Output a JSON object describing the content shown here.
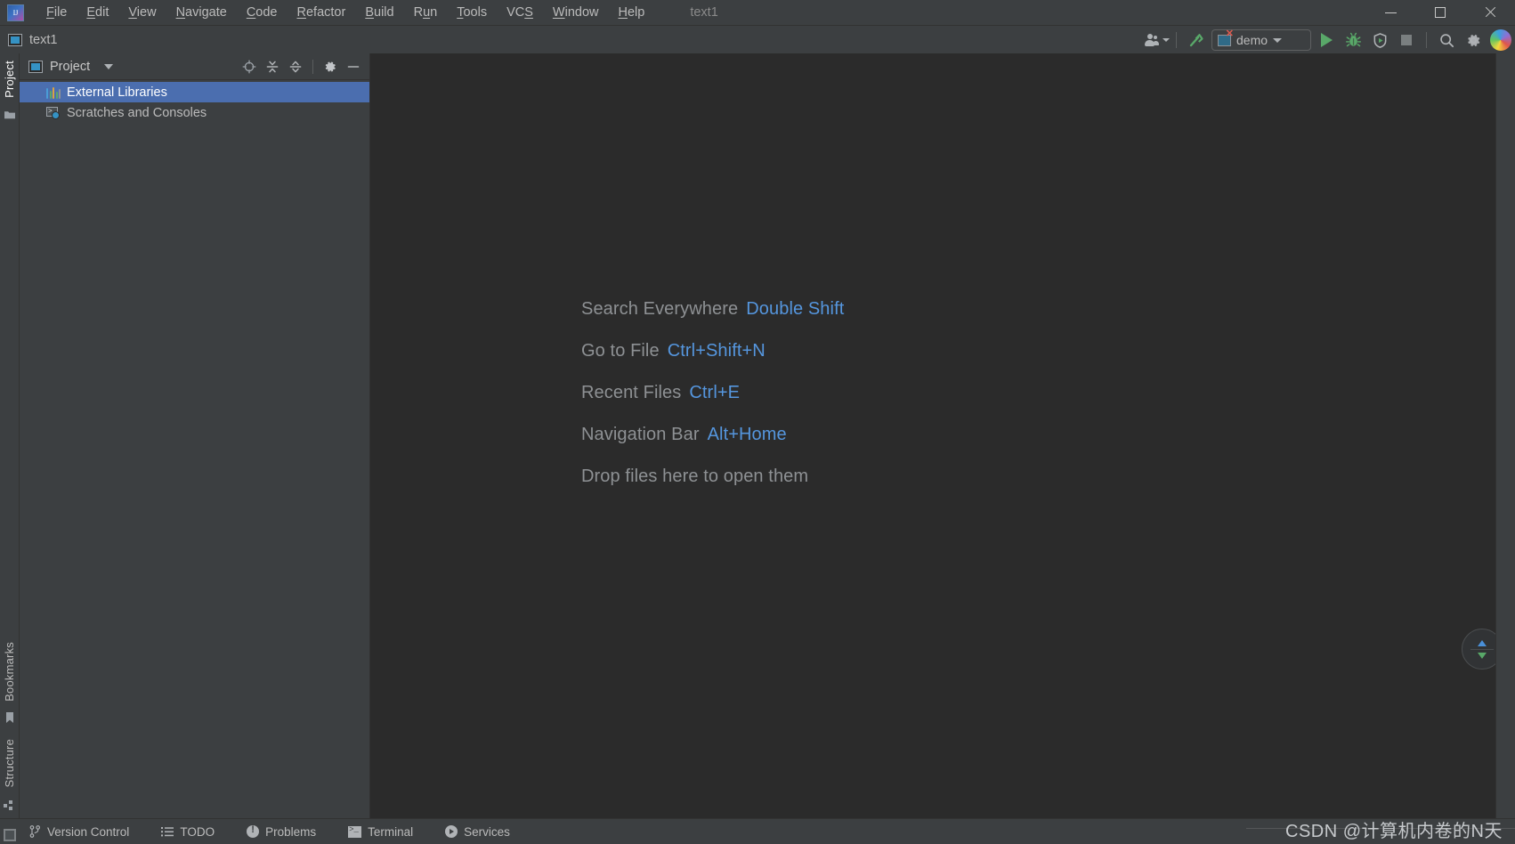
{
  "window": {
    "title": "text1",
    "logo_icon": "intellij-idea-logo",
    "controls": {
      "minimize": "minimize-icon",
      "maximize": "maximize-icon",
      "close": "close-icon"
    }
  },
  "menubar": {
    "items": [
      {
        "label": "File",
        "mnemonic": "F"
      },
      {
        "label": "Edit",
        "mnemonic": "E"
      },
      {
        "label": "View",
        "mnemonic": "V"
      },
      {
        "label": "Navigate",
        "mnemonic": "N"
      },
      {
        "label": "Code",
        "mnemonic": "C"
      },
      {
        "label": "Refactor",
        "mnemonic": "R"
      },
      {
        "label": "Build",
        "mnemonic": "B"
      },
      {
        "label": "Run",
        "mnemonic": "u"
      },
      {
        "label": "Tools",
        "mnemonic": "T"
      },
      {
        "label": "VCS",
        "mnemonic": "S"
      },
      {
        "label": "Window",
        "mnemonic": "W"
      },
      {
        "label": "Help",
        "mnemonic": "H"
      }
    ]
  },
  "navbar": {
    "project_name": "text1",
    "project_icon": "project-module-icon",
    "right_toolbar": {
      "account_icon": "account-people-icon",
      "build_icon": "build-hammer-icon",
      "run_config": {
        "name": "demo",
        "icon": "run-configuration-icon",
        "caret_icon": "chevron-down-icon"
      },
      "run_icon": "run-play-icon",
      "debug_icon": "debug-bug-icon",
      "coverage_icon": "run-with-coverage-icon",
      "stop_icon": "stop-square-icon",
      "search_icon": "search-icon",
      "settings_icon": "gear-icon",
      "avatar_icon": "user-avatar"
    }
  },
  "left_strip": {
    "top_tabs": [
      {
        "label": "Project",
        "active": true
      }
    ],
    "top_icons": [
      "folder-icon"
    ],
    "bottom_tabs": [
      {
        "label": "Bookmarks",
        "active": false
      },
      {
        "label": "Structure",
        "active": false
      }
    ],
    "bottom_icons": [
      "bookmark-icon",
      "structure-icon"
    ]
  },
  "tool_window": {
    "title": "Project",
    "title_icon": "project-view-icon",
    "dropdown_icon": "chevron-down-icon",
    "actions": [
      {
        "name": "select-opened-file-icon",
        "title": "Select Opened File"
      },
      {
        "name": "expand-all-icon",
        "title": "Expand All"
      },
      {
        "name": "collapse-all-icon",
        "title": "Collapse All"
      },
      {
        "name": "gear-icon",
        "title": "Options"
      },
      {
        "name": "hide-icon",
        "title": "Hide"
      }
    ],
    "tree": [
      {
        "label": "External Libraries",
        "icon": "external-libraries-icon",
        "selected": true,
        "bar_colors": [
          "#4a9cd6",
          "#59a869",
          "#d9a343",
          "#59a869",
          "#8f9194"
        ]
      },
      {
        "label": "Scratches and Consoles",
        "icon": "scratches-consoles-icon",
        "selected": false
      }
    ]
  },
  "editor": {
    "hints": [
      {
        "label": "Search Everywhere",
        "shortcut": "Double Shift"
      },
      {
        "label": "Go to File",
        "shortcut": "Ctrl+Shift+N"
      },
      {
        "label": "Recent Files",
        "shortcut": "Ctrl+E"
      },
      {
        "label": "Navigation Bar",
        "shortcut": "Alt+Home"
      },
      {
        "label": "Drop files here to open them",
        "shortcut": ""
      }
    ],
    "inspection_widget": {
      "previous_icon": "arrow-up-icon",
      "next_icon": "arrow-down-icon"
    },
    "colors": {
      "background": "#2b2b2b",
      "hint_label": "#8e9194",
      "hint_shortcut": "#5596de"
    }
  },
  "statusbar": {
    "items": [
      {
        "label": "Version Control",
        "icon": "branch-icon"
      },
      {
        "label": "TODO",
        "icon": "todo-list-icon"
      },
      {
        "label": "Problems",
        "icon": "problems-icon"
      },
      {
        "label": "Terminal",
        "icon": "terminal-icon"
      },
      {
        "label": "Services",
        "icon": "services-icon"
      }
    ],
    "resize_grip": "resize-grip-icon"
  },
  "watermark": {
    "text": "CSDN @计算机内卷的N天"
  },
  "theme": {
    "accent": "#4b6eaf",
    "chrome": "#3c3f41",
    "editor_bg": "#2b2b2b",
    "link": "#5596de",
    "run_green": "#59a869"
  }
}
